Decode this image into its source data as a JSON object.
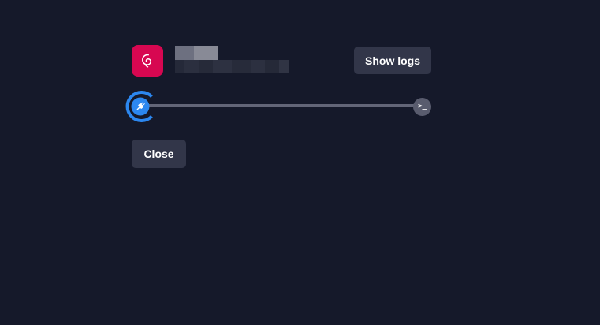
{
  "host": {
    "name": "",
    "subtitle": "",
    "icon": "debian-swirl-icon",
    "icon_color": "#d70751"
  },
  "actions": {
    "show_logs_label": "Show logs",
    "close_label": "Close"
  },
  "progress": {
    "start_icon": "plug-icon",
    "start_color": "#2c87ef",
    "end_icon": "terminal-icon",
    "end_glyph": ">_",
    "state": "connecting"
  },
  "colors": {
    "background": "#15192a",
    "button": "#323649",
    "track": "#626577"
  }
}
